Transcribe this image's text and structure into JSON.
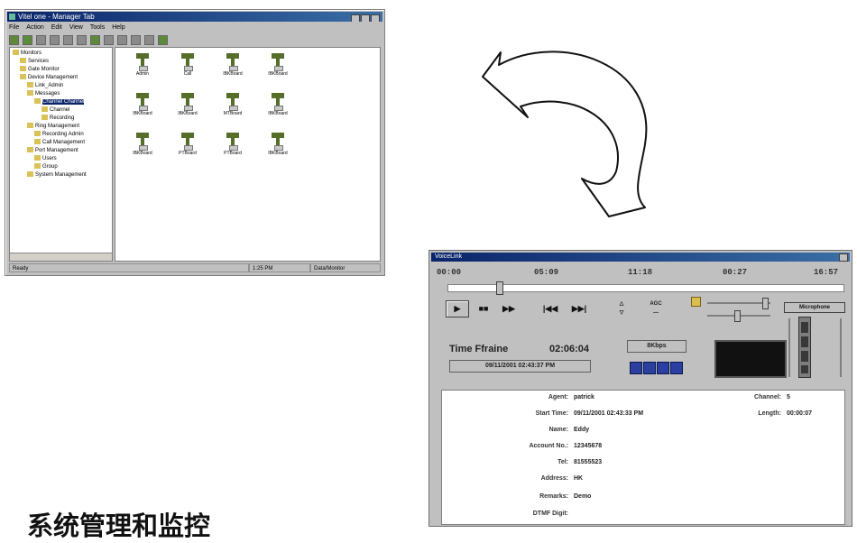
{
  "console": {
    "title": "Vitel one - Manager Tab",
    "menu": [
      "File",
      "Action",
      "Edit",
      "View",
      "Tools",
      "Help"
    ],
    "tree": [
      {
        "label": "Monitors",
        "depth": 0
      },
      {
        "label": "Services",
        "depth": 1
      },
      {
        "label": "Gate Monitor",
        "depth": 1
      },
      {
        "label": "Device Management",
        "depth": 1
      },
      {
        "label": "Link_Admin",
        "depth": 2
      },
      {
        "label": "Messages",
        "depth": 2
      },
      {
        "label": "Channel Channel",
        "depth": 3
      },
      {
        "label": "Channel",
        "depth": 4
      },
      {
        "label": "Recording",
        "depth": 4
      },
      {
        "label": "Ring Management",
        "depth": 2
      },
      {
        "label": "Recording Admin",
        "depth": 3
      },
      {
        "label": "Call Management",
        "depth": 3
      },
      {
        "label": "Port Management",
        "depth": 2
      },
      {
        "label": "Users",
        "depth": 3
      },
      {
        "label": "Group",
        "depth": 3
      },
      {
        "label": "System Management",
        "depth": 2
      }
    ],
    "files": [
      "Admin",
      "Call",
      "IBKBoard",
      "IBKBoard",
      "IBKBoard",
      "IBKBoard",
      "MTBoard",
      "IBKBoard",
      "IBKBoard",
      "PTBoard",
      "PTBoard",
      "IBKBoard"
    ],
    "status": [
      "Ready",
      "1:25 PM",
      "Data/Monitor"
    ]
  },
  "player": {
    "title": "VoiceLink",
    "timeline": [
      "00:00",
      "05:09",
      "11:18",
      "00:27",
      "16:57"
    ],
    "progress_fraction": 0.12,
    "buttons": [
      "▶",
      "■■",
      "▶▶",
      "|◀◀",
      "▶▶|"
    ],
    "aux_labels": [
      "△",
      "▽",
      "AGC",
      "—"
    ],
    "meter_label": "Microphone",
    "volume_fraction": 0.92,
    "speed_fraction": 0.45,
    "time_label": "Time Ffraine",
    "time_value": "02:06:04",
    "date_time": "09/11/2001 02:43:37 PM",
    "kbps": "8Kbps",
    "info": [
      {
        "label": "Agent:",
        "value": "patrick"
      },
      {
        "label": "Start Time:",
        "value": "09/11/2001 02:43:33 PM"
      },
      {
        "label": "Name:",
        "value": "Eddy"
      },
      {
        "label": "Account No.:",
        "value": "12345678"
      },
      {
        "label": "Tel:",
        "value": "81555523"
      },
      {
        "label": "Address:",
        "value": "HK"
      },
      {
        "label": "Remarks:",
        "value": "Demo"
      },
      {
        "label": "DTMF Digit:",
        "value": ""
      }
    ],
    "channel_label": "Channel:",
    "channel_value": "5",
    "length_label": "Length:",
    "length_value": "00:00:07"
  },
  "caption": "系统管理和监控",
  "colors": {
    "titlebar": "#0a246a",
    "window": "#c0c0c0",
    "led": "#2a3f9f",
    "icon": "#566e2a"
  }
}
